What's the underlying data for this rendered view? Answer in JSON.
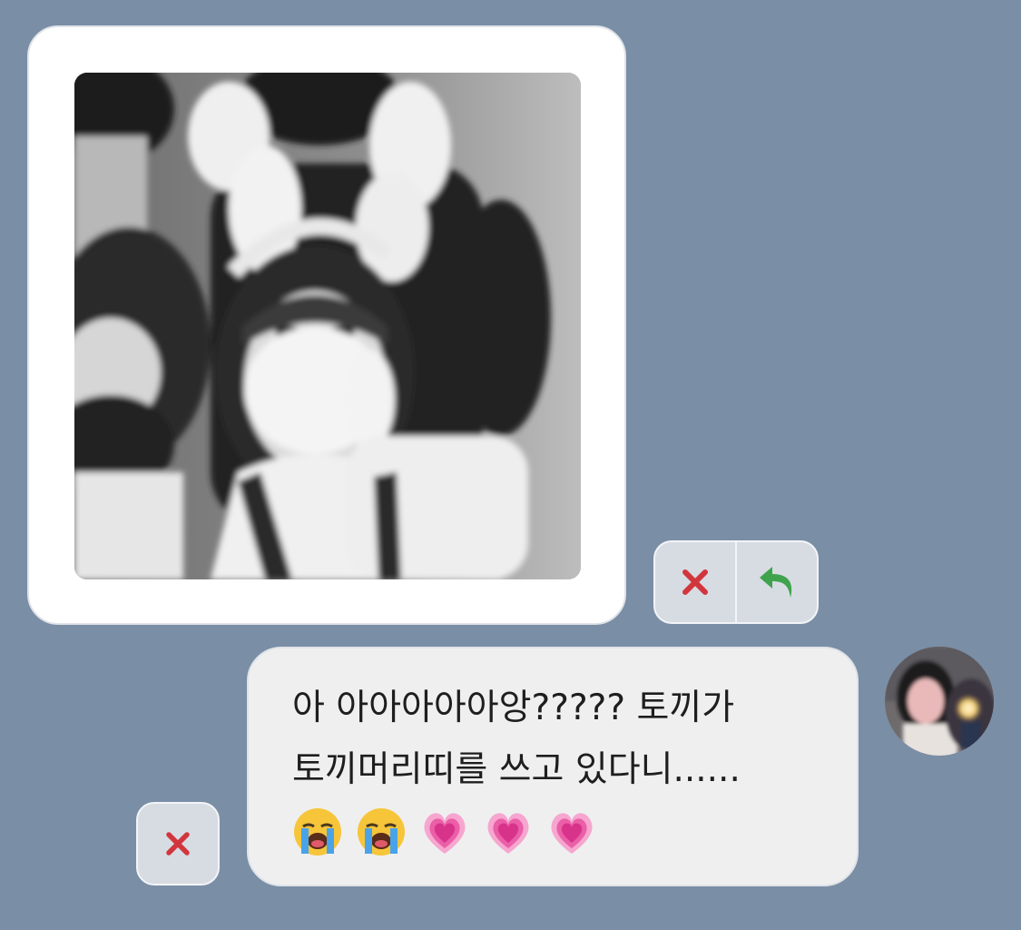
{
  "theme": {
    "background": "#7a8ea6",
    "bubble_background": "#efeff0",
    "action_background": "#d7dce3",
    "delete_color": "#d2363d",
    "reply_color": "#3fa34d"
  },
  "image_message": {
    "icon_delete": "x-icon",
    "icon_reply": "reply-arrow-icon"
  },
  "text_message": {
    "line1": "아 아아아아아앙????? 토끼가",
    "line2": "토끼머리띠를 쓰고 있다니......",
    "emojis": [
      "loudly-crying-face",
      "loudly-crying-face",
      "growing-heart",
      "growing-heart",
      "growing-heart"
    ],
    "icon_delete": "x-icon"
  },
  "avatar": {
    "icon": "user-avatar"
  }
}
